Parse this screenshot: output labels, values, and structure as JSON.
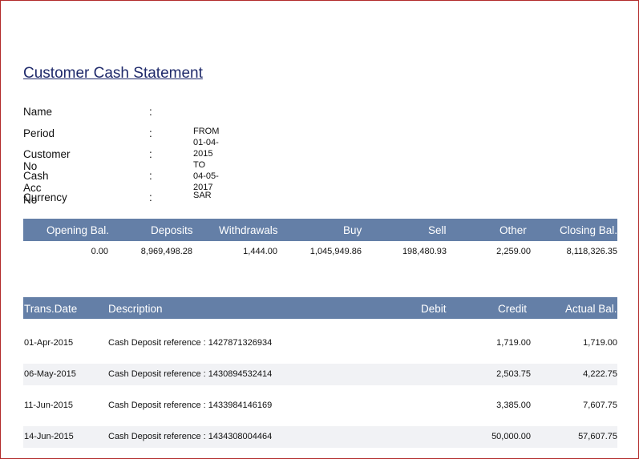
{
  "title": "Customer Cash Statement",
  "info": [
    {
      "label": "Name",
      "value": ""
    },
    {
      "label": "Period",
      "value": "FROM 01-04-2015 TO 04-05-2017"
    },
    {
      "label": "Customer No",
      "value": ""
    },
    {
      "label": "Cash Acc No",
      "value": ""
    },
    {
      "label": "Currency",
      "value": "SAR"
    }
  ],
  "colon": ":",
  "summary": {
    "headers": [
      "Opening Bal.",
      "Deposits",
      "Withdrawals",
      "Buy",
      "Sell",
      "Other",
      "Closing Bal."
    ],
    "values": [
      "0.00",
      "8,969,498.28",
      "1,444.00",
      "1,045,949.86",
      "198,480.93",
      "2,259.00",
      "8,118,326.35"
    ]
  },
  "transactions": {
    "headers": [
      "Trans.Date",
      "Description",
      "Debit",
      "Credit",
      "Actual Bal."
    ],
    "rows": [
      {
        "date": "01-Apr-2015",
        "description": "Cash Deposit  reference : 1427871326934",
        "debit": "",
        "credit": "1,719.00",
        "balance": "1,719.00"
      },
      {
        "date": "06-May-2015",
        "description": "Cash Deposit  reference : 1430894532414",
        "debit": "",
        "credit": "2,503.75",
        "balance": "4,222.75"
      },
      {
        "date": "11-Jun-2015",
        "description": "Cash Deposit  reference : 1433984146169",
        "debit": "",
        "credit": "3,385.00",
        "balance": "7,607.75"
      },
      {
        "date": "14-Jun-2015",
        "description": "Cash Deposit  reference : 1434308004464",
        "debit": "",
        "credit": "50,000.00",
        "balance": "57,607.75"
      }
    ]
  }
}
